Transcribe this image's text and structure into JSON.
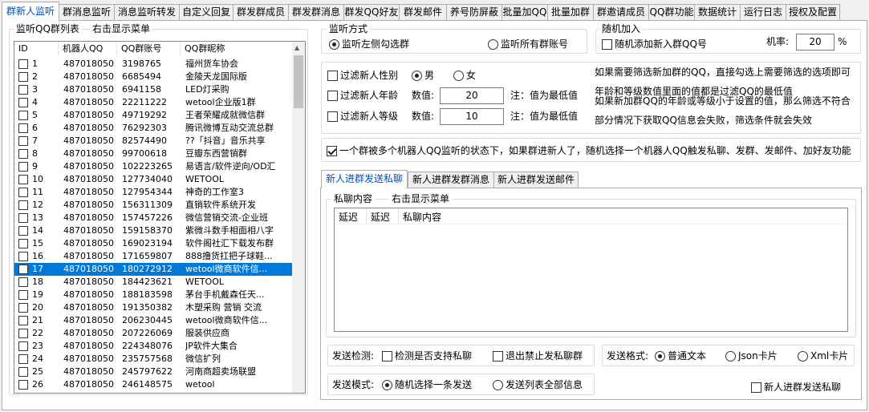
{
  "tabs": [
    {
      "label": "群新人监听",
      "active": true
    },
    {
      "label": "群消息监听"
    },
    {
      "label": "消息监听转发"
    },
    {
      "label": "自定义回复"
    },
    {
      "label": "群发群成员"
    },
    {
      "label": "群发群消息"
    },
    {
      "label": "群发QQ好友"
    },
    {
      "label": "群发邮件"
    },
    {
      "label": "养号防屏蔽"
    },
    {
      "label": "批量加QQ"
    },
    {
      "label": "批量加群"
    },
    {
      "label": "群邀请成员"
    },
    {
      "label": "QQ群功能"
    },
    {
      "label": "数据统计"
    },
    {
      "label": "运行日志"
    },
    {
      "label": "授权及配置"
    }
  ],
  "group_list": {
    "title": "监听QQ群列表",
    "menu_hint": "右击显示菜单",
    "columns": [
      "ID",
      "机器人QQ",
      "QQ群账号",
      "QQ群昵称"
    ],
    "rows": [
      [
        "1",
        "487018050",
        "3198765",
        "福州货车协会"
      ],
      [
        "2",
        "487018050",
        "6685494",
        "金陵天龙国际版"
      ],
      [
        "3",
        "487018050",
        "6941158",
        "LED灯采购"
      ],
      [
        "4",
        "487018050",
        "22211222",
        "wetool企业版1群"
      ],
      [
        "5",
        "487018050",
        "49719292",
        "王者荣耀成就微信群"
      ],
      [
        "6",
        "487018050",
        "76292303",
        "腾讯微博互动交流总群"
      ],
      [
        "7",
        "487018050",
        "82574490",
        "??「抖音」音乐共享"
      ],
      [
        "8",
        "487018050",
        "99700618",
        "豆瓣东西营销群"
      ],
      [
        "9",
        "487018050",
        "102223265",
        "易语言/软件逆向/OD汇"
      ],
      [
        "10",
        "487018050",
        "127734040",
        "WETOOL"
      ],
      [
        "11",
        "487018050",
        "127954344",
        "神奇的工作室3"
      ],
      [
        "12",
        "487018050",
        "156311309",
        "直销软件系统开发"
      ],
      [
        "13",
        "487018050",
        "157457226",
        "微信营销交流-企业班"
      ],
      [
        "14",
        "487018050",
        "159158370",
        "紫微斗数手相面相八字"
      ],
      [
        "15",
        "487018050",
        "169023194",
        "软件阁社汇下载发布群"
      ],
      [
        "16",
        "487018050",
        "171659807",
        "888撸货扛把子球鞋..."
      ],
      [
        "17",
        "487018050",
        "180272912",
        "wetool微商软件信..."
      ],
      [
        "18",
        "487018050",
        "184423621",
        "WETOOL"
      ],
      [
        "19",
        "487018050",
        "188183598",
        "茅台手机戴森任天..."
      ],
      [
        "20",
        "487018050",
        "191350382",
        "木塑采购 营销 交流"
      ],
      [
        "21",
        "487018050",
        "206230445",
        "wetool微商软件信..."
      ],
      [
        "22",
        "487018050",
        "207226069",
        "服装供应商"
      ],
      [
        "23",
        "487018050",
        "224348076",
        "JP软件大集合"
      ],
      [
        "24",
        "487018050",
        "235757568",
        "微信扩列"
      ],
      [
        "25",
        "487018050",
        "245797622",
        "河南商超卖场联盟"
      ],
      [
        "26",
        "487018050",
        "246148575",
        "wetool"
      ]
    ],
    "selected_index": 16
  },
  "monitor_mode": {
    "title": "监听方式",
    "option_left": "监听左侧勾选群",
    "option_all": "监听所有群账号"
  },
  "random_join": {
    "title": "随机加入",
    "checkbox": "随机添加新入群QQ号",
    "rate_label": "机率:",
    "rate_value": "20",
    "rate_unit": "%"
  },
  "filters": {
    "gender_label": "过滤新人性别",
    "male": "男",
    "female": "女",
    "age_label": "过滤新人年龄",
    "value_label": "数值:",
    "age_value": "20",
    "min_note": "注：值为最低值",
    "level_label": "过滤新人等级",
    "level_value": "10",
    "info1": "如果需要筛选新加群的QQ，直接勾选上需要筛选的选项即可",
    "info2": "年龄和等级数值里面的值都是过滤QQ的最低值",
    "info3": "如果新加群QQ的年龄或等级小于设置的值，那么筛选不符合",
    "info4": "部分情况下获取QQ信息会失败，筛选条件就会失效"
  },
  "multi_robot": {
    "text": "一个群被多个机器人QQ监听的状态下，如果群进新人了，随机选择一个机器人QQ触发私聊、发群、发邮件、加好友功能"
  },
  "inner_tabs": [
    "新人进群发送私聊",
    "新人进群发群消息",
    "新人进群发送邮件"
  ],
  "private_chat": {
    "title": "私聊内容",
    "menu_hint": "右击显示菜单",
    "columns": [
      "延迟",
      "延迟",
      "私聊内容"
    ]
  },
  "send_detect": {
    "label": "发送检测:",
    "check_support": "检测是否支持私聊",
    "exit_forbidden": "退出禁止发私聊群"
  },
  "send_format": {
    "label": "发送格式:",
    "plain": "普通文本",
    "json": "Json卡片",
    "xml": "Xml卡片"
  },
  "send_mode": {
    "label": "发送模式:",
    "random_one": "随机选择一条发送",
    "send_all": "发送列表全部信息"
  },
  "enable_checkbox": "新人进群发送私聊"
}
